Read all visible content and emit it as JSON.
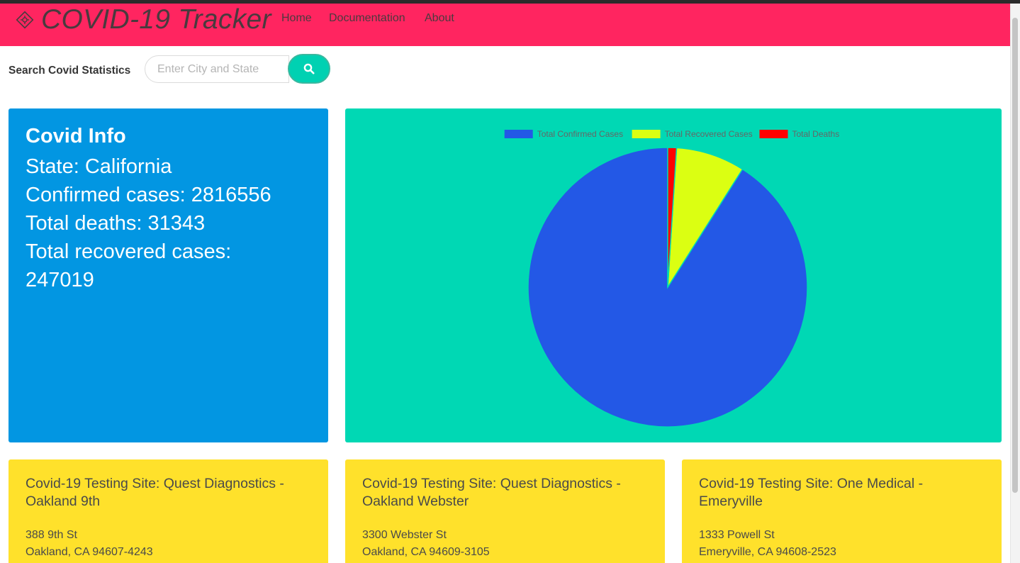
{
  "app": {
    "title": "COVID-19 Tracker",
    "icon": "virus-diamond-icon",
    "nav": [
      "Home",
      "Documentation",
      "About"
    ]
  },
  "colors": {
    "navbar": "#ff2560",
    "info_card": "#0296e2",
    "chart_card": "#00d8b4",
    "site_card": "#ffe12b",
    "accent_button": "#00d1b2"
  },
  "search": {
    "label": "Search Covid Statistics",
    "placeholder": "Enter City and State",
    "value": "",
    "icon": "search-icon"
  },
  "info": {
    "title": "Covid Info",
    "state": "State: California",
    "confirmed": "Confirmed cases: 2816556",
    "deaths": "Total deaths: 31343",
    "recovered_label": "Total recovered cases:",
    "recovered_value": "247019"
  },
  "chart_data": {
    "type": "pie",
    "categories": [
      "Total Confirmed Cases",
      "Total Recovered Cases",
      "Total Deaths"
    ],
    "values": [
      2816556,
      247019,
      31343
    ],
    "colors": [
      "#2358e6",
      "#dbff12",
      "#ff0000"
    ],
    "legend": "top",
    "start_angle_deg": -90,
    "direction": "counterclockwise"
  },
  "sites": [
    {
      "title": "Covid-19 Testing Site: Quest Diagnostics - Oakland 9th",
      "address1": "388 9th St",
      "address2": "Oakland, CA 94607-4243"
    },
    {
      "title": "Covid-19 Testing Site: Quest Diagnostics - Oakland Webster",
      "address1": "3300 Webster St",
      "address2": "Oakland, CA 94609-3105"
    },
    {
      "title": "Covid-19 Testing Site: One Medical - Emeryville",
      "address1": "1333 Powell St",
      "address2": "Emeryville, CA 94608-2523"
    }
  ]
}
